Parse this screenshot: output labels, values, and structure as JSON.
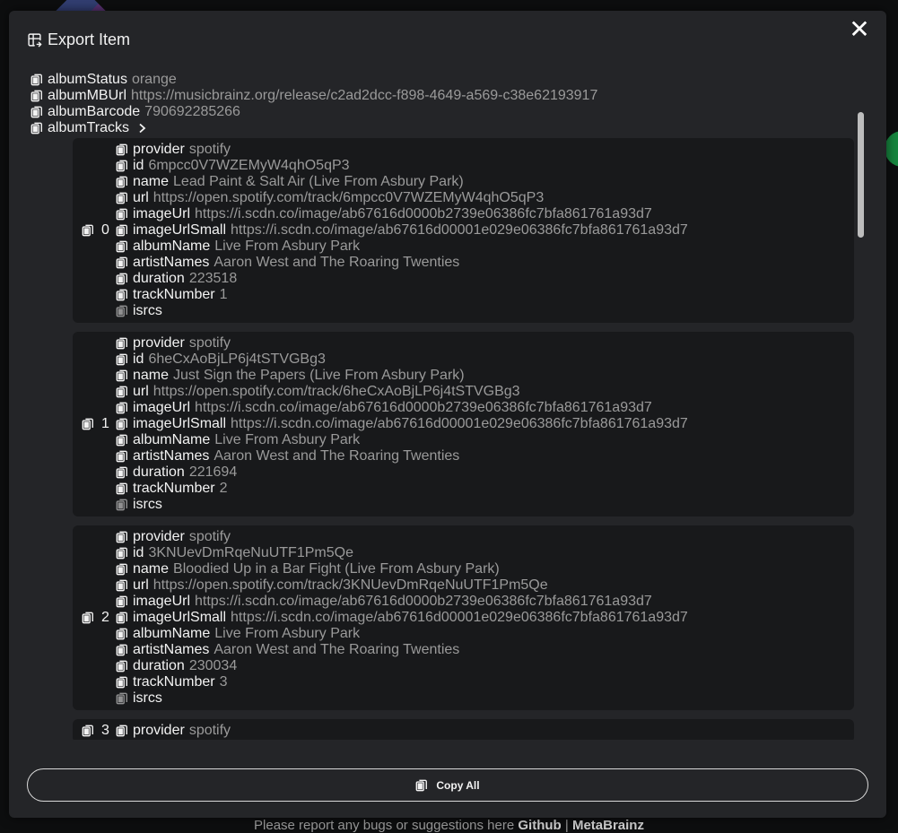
{
  "modal": {
    "title": "Export Item",
    "close_label": "✕",
    "copy_all_label": "Copy All"
  },
  "album": {
    "status": {
      "key": "albumStatus",
      "value": "orange"
    },
    "mburl": {
      "key": "albumMBUrl",
      "value": "https://musicbrainz.org/release/c2ad2dcc-f898-4649-a569-c38e62193917"
    },
    "barcode": {
      "key": "albumBarcode",
      "value": "790692285266"
    },
    "tracks_key": "albumTracks"
  },
  "tracks": [
    {
      "index": "0",
      "fields": [
        {
          "key": "provider",
          "value": "spotify"
        },
        {
          "key": "id",
          "value": "6mpcc0V7WZEMyW4qhO5qP3"
        },
        {
          "key": "name",
          "value": "Lead Paint & Salt Air (Live From Asbury Park)"
        },
        {
          "key": "url",
          "value": "https://open.spotify.com/track/6mpcc0V7WZEMyW4qhO5qP3"
        },
        {
          "key": "imageUrl",
          "value": "https://i.scdn.co/image/ab67616d0000b2739e06386fc7bfa861761a93d7"
        },
        {
          "key": "imageUrlSmall",
          "value": "https://i.scdn.co/image/ab67616d00001e029e06386fc7bfa861761a93d7"
        },
        {
          "key": "albumName",
          "value": "Live From Asbury Park"
        },
        {
          "key": "artistNames",
          "value": "Aaron West and The Roaring Twenties"
        },
        {
          "key": "duration",
          "value": "223518"
        },
        {
          "key": "trackNumber",
          "value": "1"
        },
        {
          "key": "isrcs",
          "value": ""
        }
      ]
    },
    {
      "index": "1",
      "fields": [
        {
          "key": "provider",
          "value": "spotify"
        },
        {
          "key": "id",
          "value": "6heCxAoBjLP6j4tSTVGBg3"
        },
        {
          "key": "name",
          "value": "Just Sign the Papers (Live From Asbury Park)"
        },
        {
          "key": "url",
          "value": "https://open.spotify.com/track/6heCxAoBjLP6j4tSTVGBg3"
        },
        {
          "key": "imageUrl",
          "value": "https://i.scdn.co/image/ab67616d0000b2739e06386fc7bfa861761a93d7"
        },
        {
          "key": "imageUrlSmall",
          "value": "https://i.scdn.co/image/ab67616d00001e029e06386fc7bfa861761a93d7"
        },
        {
          "key": "albumName",
          "value": "Live From Asbury Park"
        },
        {
          "key": "artistNames",
          "value": "Aaron West and The Roaring Twenties"
        },
        {
          "key": "duration",
          "value": "221694"
        },
        {
          "key": "trackNumber",
          "value": "2"
        },
        {
          "key": "isrcs",
          "value": ""
        }
      ]
    },
    {
      "index": "2",
      "fields": [
        {
          "key": "provider",
          "value": "spotify"
        },
        {
          "key": "id",
          "value": "3KNUevDmRqeNuUTF1Pm5Qe"
        },
        {
          "key": "name",
          "value": "Bloodied Up in a Bar Fight (Live From Asbury Park)"
        },
        {
          "key": "url",
          "value": "https://open.spotify.com/track/3KNUevDmRqeNuUTF1Pm5Qe"
        },
        {
          "key": "imageUrl",
          "value": "https://i.scdn.co/image/ab67616d0000b2739e06386fc7bfa861761a93d7"
        },
        {
          "key": "imageUrlSmall",
          "value": "https://i.scdn.co/image/ab67616d00001e029e06386fc7bfa861761a93d7"
        },
        {
          "key": "albumName",
          "value": "Live From Asbury Park"
        },
        {
          "key": "artistNames",
          "value": "Aaron West and The Roaring Twenties"
        },
        {
          "key": "duration",
          "value": "230034"
        },
        {
          "key": "trackNumber",
          "value": "3"
        },
        {
          "key": "isrcs",
          "value": ""
        }
      ]
    },
    {
      "index": "3",
      "fields": [
        {
          "key": "provider",
          "value": "spotify"
        }
      ]
    }
  ],
  "footer": {
    "text": "Please report any bugs or suggestions here",
    "github": "Github",
    "sep": "|",
    "metabrainz": "MetaBrainz"
  }
}
